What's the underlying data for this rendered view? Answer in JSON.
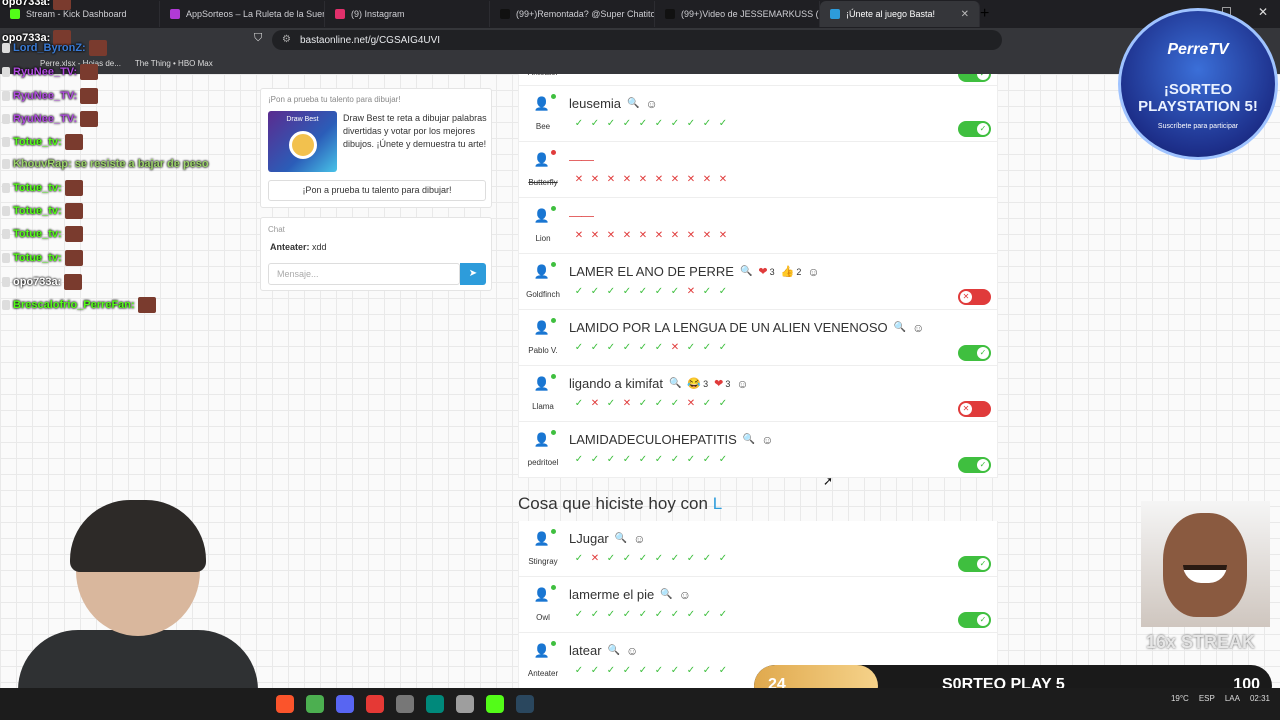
{
  "browser": {
    "tabs": [
      {
        "label": "Stream - Kick Dashboard",
        "color": "#53fc18"
      },
      {
        "label": "AppSorteos – La Ruleta de la Suerte",
        "color": "#b13ad6"
      },
      {
        "label": "(9) Instagram",
        "color": "#e1306c"
      },
      {
        "label": "(99+)Remontada? @Super Chatitos",
        "color": "#111111"
      },
      {
        "label": "(99+)Video de JESSEMARKUSS (@jes",
        "color": "#111111"
      },
      {
        "label": "¡Únete al juego Basta!",
        "color": "#2d9cdb",
        "active": true
      }
    ],
    "new_tab": "+",
    "url": "bastaonline.net/g/CGSAIG4UVI",
    "bookmarks": [
      "Perre.xlsx - Hojas de...",
      "The Thing • HBO Max"
    ]
  },
  "promo": {
    "title": "¡Pon a prueba tu talento para dibujar!",
    "image_label": "Draw Best",
    "text": "Draw Best te reta a dibujar palabras divertidas y votar por los mejores dibujos. ¡Únete y demuestra tu arte!",
    "button": "¡Pon a prueba tu talento para dibujar!"
  },
  "chat": {
    "title": "Chat",
    "author": "Anteater:",
    "message": "xdd",
    "placeholder": "Mensaje..."
  },
  "partial_top": {
    "player": "Anteater"
  },
  "answers": [
    {
      "player": "Bee",
      "word": "leusemia",
      "online": "#3fbf3f",
      "votes": [
        "ok",
        "ok",
        "ok",
        "ok",
        "ok",
        "ok",
        "ok",
        "ok",
        "ok",
        "ok"
      ],
      "status": "on",
      "hearts": "",
      "likes": "",
      "laughs": ""
    },
    {
      "player": "Butterfly",
      "word": "——",
      "online": "#e03b3b",
      "strike": true,
      "votes": [
        "no",
        "no",
        "no",
        "no",
        "no",
        "no",
        "no",
        "no",
        "no",
        "no"
      ],
      "status": "",
      "hearts": "",
      "likes": "",
      "laughs": ""
    },
    {
      "player": "Lion",
      "word": "——",
      "online": "#3fbf3f",
      "votes": [
        "no",
        "no",
        "no",
        "no",
        "no",
        "no",
        "no",
        "no",
        "no",
        "no"
      ],
      "status": "",
      "hearts": "",
      "likes": "",
      "laughs": ""
    },
    {
      "player": "Goldfinch",
      "word": "LAMER EL ANO DE PERRE",
      "online": "#3fbf3f",
      "votes": [
        "ok",
        "ok",
        "ok",
        "ok",
        "ok",
        "ok",
        "ok",
        "no",
        "ok",
        "ok"
      ],
      "status": "off",
      "hearts": "3",
      "likes": "2",
      "laughs": ""
    },
    {
      "player": "Pablo V.",
      "word": "LAMIDO POR LA LENGUA DE UN ALIEN VENENOSO",
      "online": "#3fbf3f",
      "votes": [
        "ok",
        "ok",
        "ok",
        "ok",
        "ok",
        "ok",
        "no",
        "ok",
        "ok",
        "ok"
      ],
      "status": "on",
      "hearts": "",
      "likes": "",
      "laughs": ""
    },
    {
      "player": "Llama",
      "word": "ligando a kimifat",
      "online": "#3fbf3f",
      "votes": [
        "ok",
        "no",
        "ok",
        "no",
        "ok",
        "ok",
        "ok",
        "no",
        "ok",
        "ok"
      ],
      "status": "off",
      "hearts": "3",
      "likes": "",
      "laughs": "3"
    },
    {
      "player": "pedritoel",
      "word": "LAMIDADECULOHEPATITIS",
      "online": "#3fbf3f",
      "votes": [
        "ok",
        "ok",
        "ok",
        "ok",
        "ok",
        "ok",
        "ok",
        "ok",
        "ok",
        "ok"
      ],
      "status": "on",
      "hearts": "",
      "likes": "",
      "laughs": ""
    }
  ],
  "section2": {
    "prefix": "Cosa que hiciste hoy con",
    "letter": "L"
  },
  "answers2": [
    {
      "player": "Stingray",
      "word": "LJugar",
      "online": "#3fbf3f",
      "votes": [
        "ok",
        "no",
        "ok",
        "ok",
        "ok",
        "ok",
        "ok",
        "ok",
        "ok",
        "ok"
      ],
      "status": "on"
    },
    {
      "player": "Owl",
      "word": "lamerme el pie",
      "online": "#3fbf3f",
      "votes": [
        "ok",
        "ok",
        "ok",
        "ok",
        "ok",
        "ok",
        "ok",
        "ok",
        "ok",
        "ok"
      ],
      "status": "on"
    },
    {
      "player": "Anteater",
      "word": "latear",
      "online": "#3fbf3f",
      "votes": [
        "ok",
        "ok",
        "ok",
        "ok",
        "ok",
        "ok",
        "ok",
        "ok",
        "ok",
        "ok"
      ],
      "status": "on"
    }
  ],
  "stream_chat": [
    {
      "text": "opo733a:",
      "color": "#ffffff",
      "top": 0
    },
    {
      "text": "Stream - Kick Dashboard",
      "color": "#ffffff",
      "top": 0
    },
    {
      "text": "opo733a:",
      "color": "#ffffff",
      "top": 0
    },
    {
      "text": "Lord_ByronZ:",
      "color": "#3a7bd5",
      "top": 0
    },
    {
      "text": "RyuNee_TV:",
      "color": "#b04ae0",
      "top": 0
    },
    {
      "text": "RyuNee_TV:",
      "color": "#b04ae0",
      "top": 0
    },
    {
      "text": "RyuNee_TV:",
      "color": "#b04ae0",
      "top": 0
    },
    {
      "text": "Totue_tv:",
      "color": "#53fc18",
      "top": 0
    },
    {
      "text": "KhouvRap: se resiste a bajar de peso",
      "color": "#9bd36a",
      "top": 0
    },
    {
      "text": "Totue_tv:",
      "color": "#53fc18",
      "top": 0
    },
    {
      "text": "Totue_tv:",
      "color": "#53fc18",
      "top": 0
    },
    {
      "text": "Totue_tv:",
      "color": "#53fc18",
      "top": 0
    },
    {
      "text": "Totue_tv:",
      "color": "#53fc18",
      "top": 0
    },
    {
      "text": "opo733a:",
      "color": "#ffffff",
      "top": 0
    },
    {
      "text": "Brescalofrio_PerreFan:",
      "color": "#53fc18",
      "top": 0
    }
  ],
  "sorteo": {
    "brand": "PerreTV",
    "title": "¡SORTEO PLAYSTATION 5!",
    "subtitle": "Suscríbete para participar"
  },
  "streak": "16x STREAK",
  "progress": {
    "start": "24",
    "label": "S0RTEO PLAY 5",
    "end": "100",
    "fraction": 0.24
  },
  "taskbar": {
    "lang": "ESP",
    "region": "LAA",
    "weather": "19°C",
    "time": "02:31"
  }
}
